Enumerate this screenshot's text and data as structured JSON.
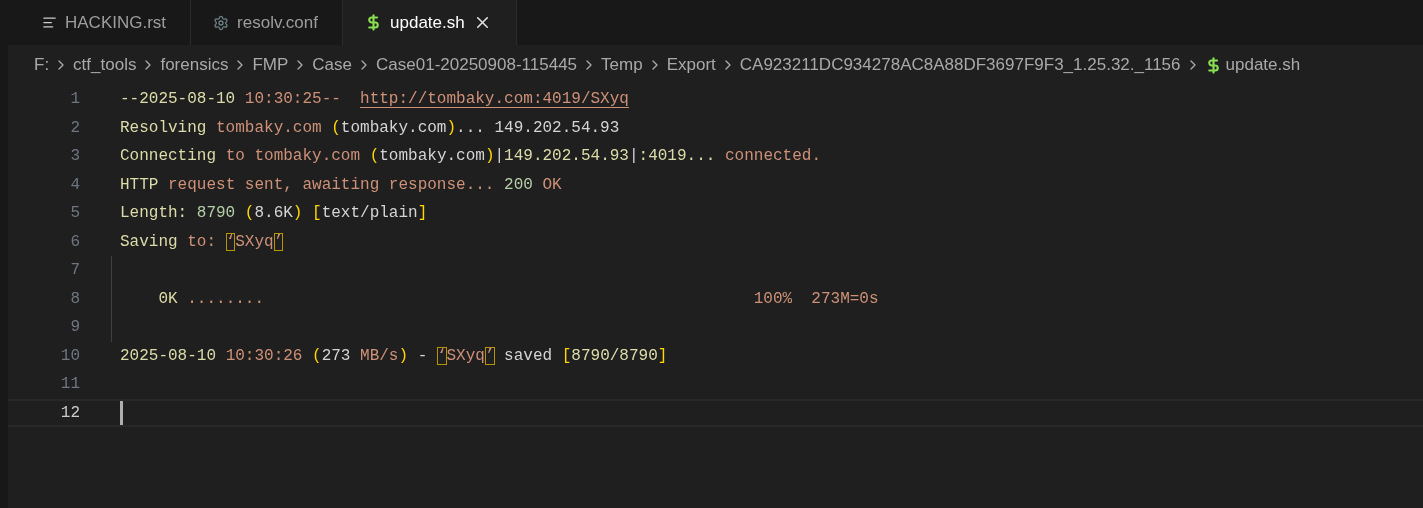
{
  "tabs": [
    {
      "label": "HACKING.rst",
      "kind": "lines",
      "selected": false
    },
    {
      "label": "resolv.conf",
      "kind": "gear",
      "selected": false
    },
    {
      "label": "update.sh",
      "kind": "dollar",
      "selected": true
    }
  ],
  "breadcrumbs": [
    {
      "label": "F:"
    },
    {
      "label": "ctf_tools"
    },
    {
      "label": "forensics"
    },
    {
      "label": "FMP"
    },
    {
      "label": "Case"
    },
    {
      "label": "Case01-20250908-115445"
    },
    {
      "label": "Temp"
    },
    {
      "label": "Export"
    },
    {
      "label": "CA923211DC934278AC8A88DF3697F9F3_1.25.32._1156"
    },
    {
      "label": "update.sh",
      "kind": "dollar"
    }
  ],
  "lines": [
    {
      "number": "1",
      "current": false,
      "guide": false,
      "tokens": [
        {
          "kind": "keyword",
          "text": "--2025-08-10 "
        },
        {
          "kind": "string",
          "text": "10:30:25--  "
        },
        {
          "kind": "link",
          "text": "http://tombaky.com:4019/SXyq"
        }
      ]
    },
    {
      "number": "2",
      "current": false,
      "guide": false,
      "tokens": [
        {
          "kind": "keyword",
          "text": "Resolving "
        },
        {
          "kind": "string",
          "text": "tombaky.com "
        },
        {
          "kind": "bracket",
          "text": "("
        },
        {
          "kind": "plain",
          "text": "tombaky.com"
        },
        {
          "kind": "bracket",
          "text": ")"
        },
        {
          "kind": "plain",
          "text": "... 149.202.54.93"
        }
      ]
    },
    {
      "number": "3",
      "current": false,
      "guide": false,
      "tokens": [
        {
          "kind": "keyword",
          "text": "Connecting "
        },
        {
          "kind": "string",
          "text": "to tombaky.com "
        },
        {
          "kind": "bracket",
          "text": "("
        },
        {
          "kind": "plain",
          "text": "tombaky.com"
        },
        {
          "kind": "bracket",
          "text": ")"
        },
        {
          "kind": "plain",
          "text": "|"
        },
        {
          "kind": "keyword",
          "text": "149.202.54.93"
        },
        {
          "kind": "plain",
          "text": "|"
        },
        {
          "kind": "keyword",
          "text": ":4019... "
        },
        {
          "kind": "string",
          "text": "connected."
        }
      ]
    },
    {
      "number": "4",
      "current": false,
      "guide": false,
      "tokens": [
        {
          "kind": "keyword",
          "text": "HTTP "
        },
        {
          "kind": "string",
          "text": "request sent, awaiting response... "
        },
        {
          "kind": "number",
          "text": "200 "
        },
        {
          "kind": "string",
          "text": "OK"
        }
      ]
    },
    {
      "number": "5",
      "current": false,
      "guide": false,
      "tokens": [
        {
          "kind": "keyword",
          "text": "Length: "
        },
        {
          "kind": "number",
          "text": "8790 "
        },
        {
          "kind": "bracket",
          "text": "("
        },
        {
          "kind": "plain",
          "text": "8.6K"
        },
        {
          "kind": "bracket",
          "text": ")"
        },
        {
          "kind": "bracket",
          "text": " ["
        },
        {
          "kind": "plain",
          "text": "text/plain"
        },
        {
          "kind": "bracket",
          "text": "]"
        }
      ]
    },
    {
      "number": "6",
      "current": false,
      "guide": false,
      "tokens": [
        {
          "kind": "keyword",
          "text": "Saving "
        },
        {
          "kind": "string",
          "text": "to: "
        },
        {
          "kind": "quote",
          "text": "‘"
        },
        {
          "kind": "string",
          "text": "SXyq"
        },
        {
          "kind": "quote",
          "text": "’"
        }
      ]
    },
    {
      "number": "7",
      "current": false,
      "guide": true
    },
    {
      "number": "8",
      "current": false,
      "guide": true,
      "tokens": [
        {
          "kind": "keyword",
          "text": "    0K "
        },
        {
          "kind": "string",
          "text": "........                                                   100%  273M=0s"
        }
      ]
    },
    {
      "number": "9",
      "current": false,
      "guide": true
    },
    {
      "number": "10",
      "current": false,
      "guide": false,
      "tokens": [
        {
          "kind": "keyword",
          "text": "2025-08-10 "
        },
        {
          "kind": "string",
          "text": "10:30:26 "
        },
        {
          "kind": "bracket",
          "text": "("
        },
        {
          "kind": "plain",
          "text": "273 "
        },
        {
          "kind": "string",
          "text": "MB/s"
        },
        {
          "kind": "bracket",
          "text": ")"
        },
        {
          "kind": "plain",
          "text": " - "
        },
        {
          "kind": "quote",
          "text": "‘"
        },
        {
          "kind": "string",
          "text": "SXyq"
        },
        {
          "kind": "quote",
          "text": "’"
        },
        {
          "kind": "plain",
          "text": " saved "
        },
        {
          "kind": "bracket",
          "text": "["
        },
        {
          "kind": "keyword",
          "text": "8790/8790"
        },
        {
          "kind": "bracket",
          "text": "]"
        }
      ]
    },
    {
      "number": "11",
      "current": false,
      "guide": false
    },
    {
      "number": "12",
      "current": true,
      "guide": false
    }
  ]
}
